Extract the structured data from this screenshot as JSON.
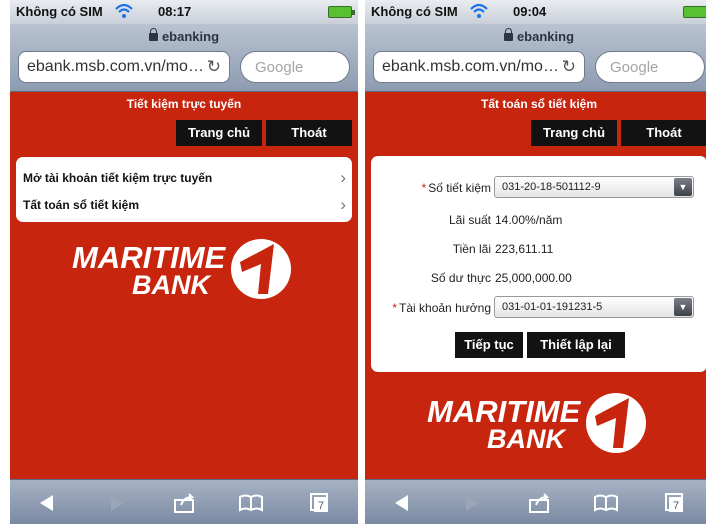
{
  "screens": {
    "left": {
      "status": {
        "carrier": "Không có SIM",
        "time": "08:17"
      },
      "browser": {
        "title": "ebanking",
        "url": "ebank.msb.com.vn/mo…",
        "search_placeholder": "Google"
      },
      "page_heading": "Tiết kiệm trực tuyến",
      "nav": {
        "home": "Trang chủ",
        "exit": "Thoát"
      },
      "menu": [
        {
          "label": "Mở tài khoản tiết kiệm trực tuyến"
        },
        {
          "label": "Tất toán sổ tiết kiệm"
        }
      ],
      "logo": {
        "line1": "MARITIME",
        "line2": "BANK"
      }
    },
    "right": {
      "status": {
        "carrier": "Không có SIM",
        "time": "09:04"
      },
      "browser": {
        "title": "ebanking",
        "url": "ebank.msb.com.vn/mo…",
        "search_placeholder": "Google"
      },
      "page_heading": "Tất toán sổ tiết kiệm",
      "nav": {
        "home": "Trang chủ",
        "exit": "Thoát"
      },
      "form": {
        "savings_book_label": "Số tiết kiệm",
        "savings_book_value": "031-20-18-501112-9",
        "interest_rate_label": "Lãi suất",
        "interest_rate_value": "14.00%/năm",
        "interest_label": "Tiền lãi",
        "interest_value": "223,611.11",
        "balance_label": "Số dư thực",
        "balance_value": "25,000,000.00",
        "beneficiary_label": "Tài khoản hưởng",
        "beneficiary_value": "031-01-01-191231-5",
        "continue_button": "Tiếp tục",
        "reset_button": "Thiết lập lại",
        "required_mark": "*"
      },
      "logo": {
        "line1": "MARITIME",
        "line2": "BANK"
      }
    }
  },
  "icons": [
    "wifi-icon",
    "battery-icon",
    "lock-icon",
    "reload-icon",
    "chevron-right-icon",
    "back-icon",
    "forward-icon",
    "share-icon",
    "bookmarks-icon",
    "tabs-icon",
    "dropdown-arrow-icon"
  ],
  "toolbar": {
    "tabs_count": "7"
  },
  "colors": {
    "brand_red": "#c8250f",
    "button_black": "#121212"
  }
}
